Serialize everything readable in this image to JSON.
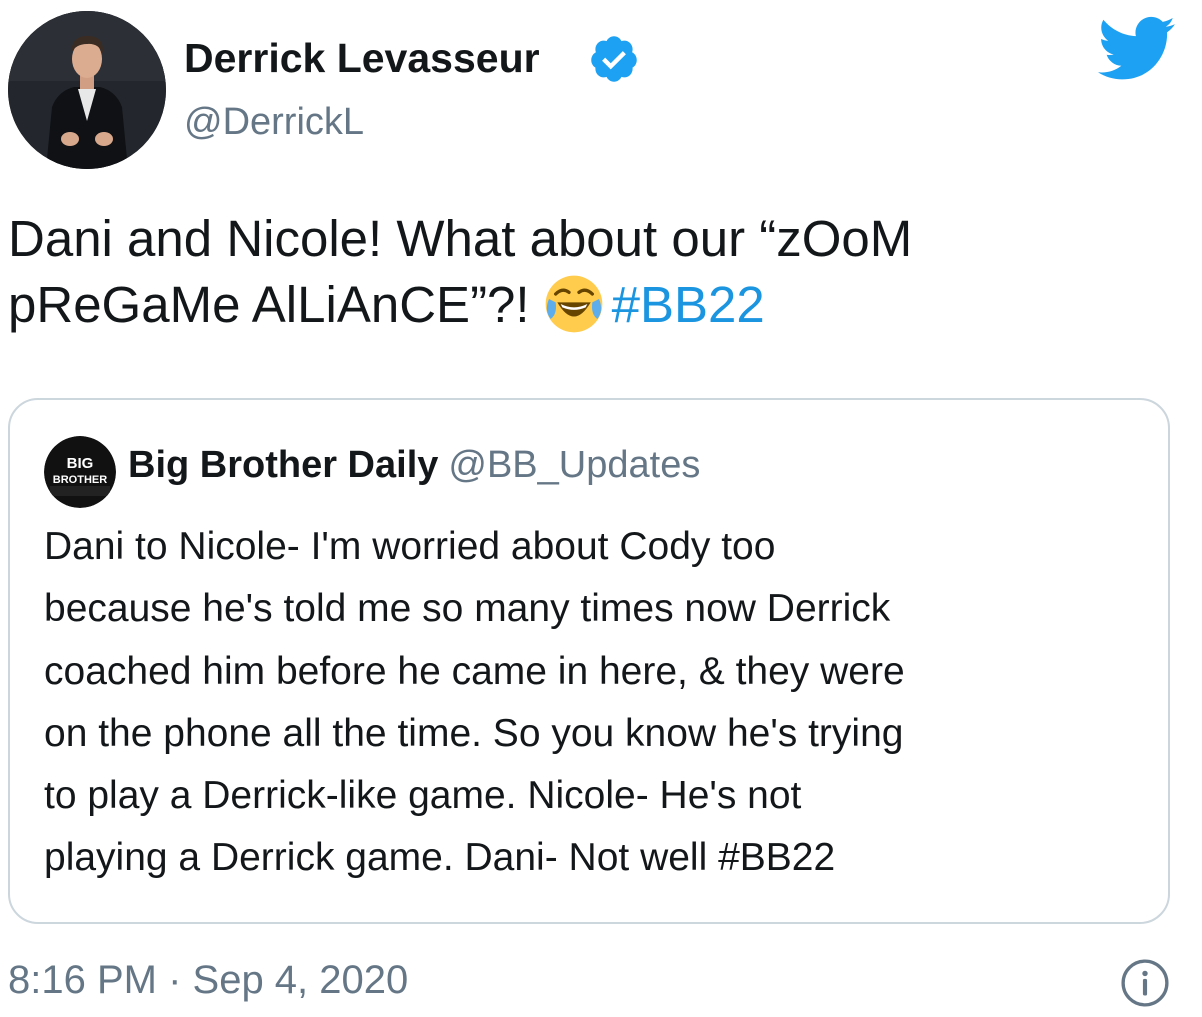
{
  "author": {
    "name": "Derrick Levasseur",
    "handle": "@DerrickL"
  },
  "tweet": {
    "line1": "Dani and Nicole! What about our “zOoM",
    "line2_text": "pReGaMe AlLiAnCE”?!",
    "hashtag": "#BB22",
    "emoji": "face-with-tears-of-joy"
  },
  "quoted_tweet": {
    "avatar_text_top": "BIG",
    "avatar_text_bottom": "BROTHER",
    "name": "Big Brother Daily",
    "handle": "@BB_Updates",
    "lines": [
      "Dani to Nicole- I'm worried about Cody too",
      "because he's told me so many times now Derrick",
      "coached him before he came in here, & they were",
      "on the phone all the time. So you know he's trying",
      "to play a Derrick-like game. Nicole- He's not",
      "playing a Derrick game. Dani- Not well #BB22"
    ]
  },
  "timestamp": "8:16 PM · Sep 4, 2020",
  "colors": {
    "twitter_blue": "#1da1f2",
    "hashtag": "#1b95e0",
    "secondary_text": "#657786",
    "border": "#ccd6dd"
  },
  "icons": {
    "verified": "verified-badge-icon",
    "brand": "twitter-bird-icon",
    "info": "info-icon"
  }
}
